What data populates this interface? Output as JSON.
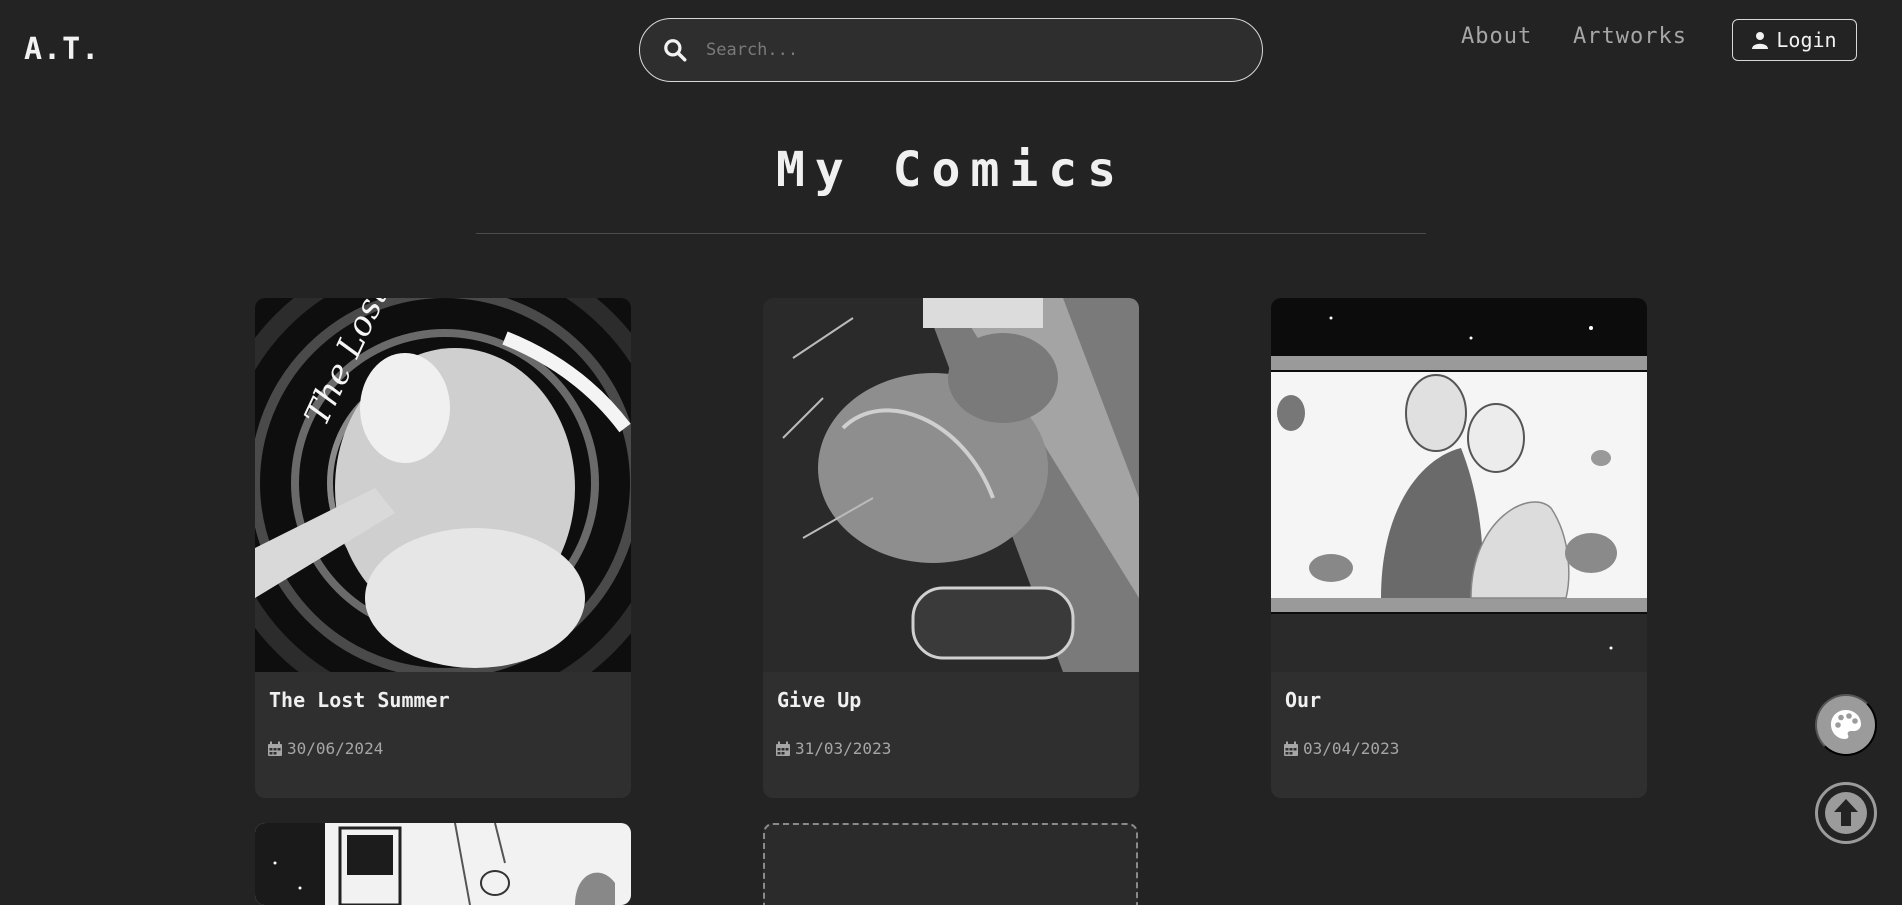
{
  "brand": {
    "logo": "A.T."
  },
  "search": {
    "placeholder": "Search..."
  },
  "nav": {
    "links": [
      {
        "label": "About"
      },
      {
        "label": "Artworks"
      }
    ],
    "login_label": "Login"
  },
  "page": {
    "title": "My Comics"
  },
  "comics": [
    {
      "title": "The Lost Summer",
      "date": "30/06/2024"
    },
    {
      "title": "Give Up",
      "date": "31/03/2023"
    },
    {
      "title": "Our",
      "date": "03/04/2023"
    }
  ],
  "icons": {
    "search": "search-icon",
    "user": "user-icon",
    "calendar": "calendar-icon",
    "palette": "palette-icon",
    "scroll_top": "arrow-up-circle-icon"
  },
  "colors": {
    "background": "#232323",
    "card": "#2f2f2f",
    "text": "#f0f0f0",
    "muted": "#a6a6a6",
    "fab": "#9b9b9b"
  }
}
